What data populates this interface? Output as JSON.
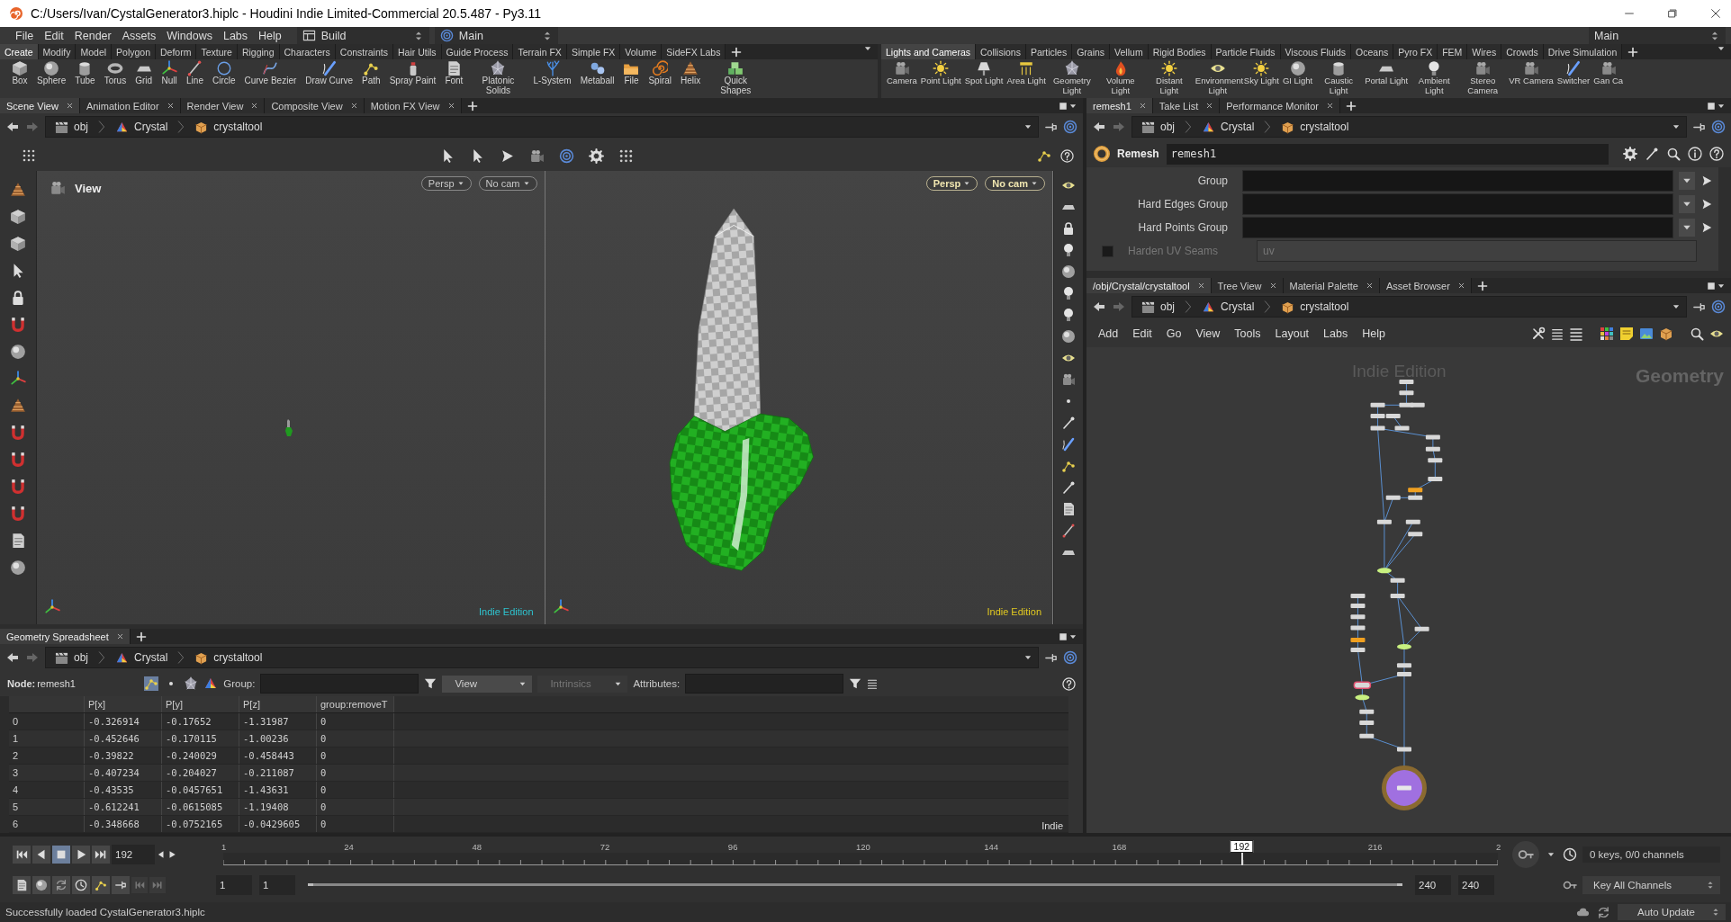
{
  "window": {
    "title": "C:/Users/Ivan/CystalGenerator3.hiplc - Houdini Indie Limited-Commercial 20.5.487 - Py3.11"
  },
  "menu": [
    "File",
    "Edit",
    "Render",
    "Assets",
    "Windows",
    "Labs",
    "Help"
  ],
  "desktop": "Build",
  "context": "Main",
  "right_selector": "Main",
  "shelves": [
    {
      "tabs": [
        {
          "label": "Create",
          "selected": true
        },
        {
          "label": "Modify",
          "selected": false
        },
        {
          "label": "Model",
          "selected": false
        },
        {
          "label": "Polygon",
          "selected": false
        },
        {
          "label": "Deform",
          "selected": false
        },
        {
          "label": "Texture",
          "selected": false
        },
        {
          "label": "Rigging",
          "selected": false
        },
        {
          "label": "Characters",
          "selected": false
        },
        {
          "label": "Constraints",
          "selected": false
        },
        {
          "label": "Hair Utils",
          "selected": false
        },
        {
          "label": "Guide Process",
          "selected": false
        },
        {
          "label": "Terrain FX",
          "selected": false
        },
        {
          "label": "Simple FX",
          "selected": false
        },
        {
          "label": "Volume",
          "selected": false
        },
        {
          "label": "SideFX Labs",
          "selected": false
        }
      ],
      "tools": [
        "Box",
        "Sphere",
        "Tube",
        "Torus",
        "Grid",
        "Null",
        "Line",
        "Circle",
        "Curve Bezier",
        "Draw Curve",
        "Path",
        "Spray Paint",
        "Font",
        "Platonic Solids",
        "L-System",
        "Metaball",
        "File",
        "Spiral",
        "Helix",
        "Quick Shapes"
      ]
    },
    {
      "tabs": [
        {
          "label": "Lights and Cameras",
          "selected": true
        },
        {
          "label": "Collisions",
          "selected": false
        },
        {
          "label": "Particles",
          "selected": false
        },
        {
          "label": "Grains",
          "selected": false
        },
        {
          "label": "Vellum",
          "selected": false
        },
        {
          "label": "Rigid Bodies",
          "selected": false
        },
        {
          "label": "Particle Fluids",
          "selected": false
        },
        {
          "label": "Viscous Fluids",
          "selected": false
        },
        {
          "label": "Oceans",
          "selected": false
        },
        {
          "label": "Pyro FX",
          "selected": false
        },
        {
          "label": "FEM",
          "selected": false
        },
        {
          "label": "Wires",
          "selected": false
        },
        {
          "label": "Crowds",
          "selected": false
        },
        {
          "label": "Drive Simulation",
          "selected": false
        }
      ],
      "tools": [
        "Camera",
        "Point Light",
        "Spot Light",
        "Area Light",
        "Geometry Light",
        "Volume Light",
        "Distant Light",
        "Environment Light",
        "Sky Light",
        "GI Light",
        "Caustic Light",
        "Portal Light",
        "Ambient Light",
        "Stereo Camera",
        "VR Camera",
        "Switcher",
        "Gan Ca"
      ]
    }
  ],
  "scene": {
    "tabs": [
      {
        "label": "Scene View",
        "selected": true
      },
      {
        "label": "Animation Editor",
        "selected": false
      },
      {
        "label": "Render View",
        "selected": false
      },
      {
        "label": "Composite View",
        "selected": false
      },
      {
        "label": "Motion FX View",
        "selected": false
      }
    ],
    "path": [
      "obj",
      "Crystal",
      "crystaltool"
    ],
    "viewports": [
      {
        "title": "View",
        "projection": "Persp",
        "camera": "No cam",
        "watermark": "Indie Edition",
        "active": false
      },
      {
        "projection": "Persp",
        "camera": "No cam",
        "watermark": "Indie Edition",
        "active": true
      }
    ]
  },
  "spreadsheet": {
    "tabs": [
      {
        "label": "Geometry Spreadsheet",
        "selected": true
      }
    ],
    "path": [
      "obj",
      "Crystal",
      "crystaltool"
    ],
    "node_label": "Node:",
    "node": "remesh1",
    "group_label": "Group:",
    "view": "View",
    "intrinsics": "Intrinsics",
    "attributes_label": "Attributes:",
    "columns": [
      "P[x]",
      "P[y]",
      "P[z]",
      "group:removeT"
    ],
    "rows": [
      {
        "index": "0",
        "cells": [
          "-0.326914",
          "-0.17652",
          "-1.31987",
          "0"
        ]
      },
      {
        "index": "1",
        "cells": [
          "-0.452646",
          "-0.170115",
          "-1.00236",
          "0"
        ]
      },
      {
        "index": "2",
        "cells": [
          "-0.39822",
          "-0.240029",
          "-0.458443",
          "0"
        ]
      },
      {
        "index": "3",
        "cells": [
          "-0.407234",
          "-0.204027",
          "-0.211087",
          "0"
        ]
      },
      {
        "index": "4",
        "cells": [
          "-0.43535",
          "-0.0457651",
          "-1.43631",
          "0"
        ]
      },
      {
        "index": "5",
        "cells": [
          "-0.612241",
          "-0.0615085",
          "-1.19408",
          "0"
        ]
      },
      {
        "index": "6",
        "cells": [
          "-0.348668",
          "-0.0752165",
          "-0.0429605",
          "0"
        ]
      }
    ],
    "watermark": "Indie"
  },
  "parameters": {
    "tabs": [
      {
        "label": "remesh1",
        "selected": true
      },
      {
        "label": "Take List",
        "selected": false
      },
      {
        "label": "Performance Monitor",
        "selected": false
      }
    ],
    "path": [
      "obj",
      "Crystal",
      "crystaltool"
    ],
    "node_type": "Remesh",
    "node_name": "remesh1",
    "fields": [
      {
        "kind": "text",
        "label": "Group"
      },
      {
        "kind": "text",
        "label": "Hard Edges Group"
      },
      {
        "kind": "text",
        "label": "Hard Points Group"
      },
      {
        "kind": "checkbox",
        "label": "Harden UV Seams",
        "checked": false,
        "disabled": true,
        "value": "uv"
      }
    ]
  },
  "network": {
    "tabs": [
      {
        "label": "/obj/Crystal/crystaltool",
        "selected": true
      },
      {
        "label": "Tree View",
        "selected": false
      },
      {
        "label": "Material Palette",
        "selected": false
      },
      {
        "label": "Asset Browser",
        "selected": false
      }
    ],
    "path": [
      "obj",
      "Crystal",
      "crystaltool"
    ],
    "menu": [
      "Add",
      "Edit",
      "Go",
      "View",
      "Tools",
      "Layout",
      "Labs",
      "Help"
    ],
    "watermark": "Indie Edition",
    "context_label": "Geometry"
  },
  "timeline": {
    "frame": "192",
    "playing": false,
    "ticks": [
      "1",
      "24",
      "48",
      "72",
      "96",
      "120",
      "144",
      "168",
      "216",
      "2"
    ],
    "current": "192",
    "level": 0.799,
    "start": "1",
    "range_start": "1",
    "range_end": "240",
    "end": "240",
    "keys": "0 keys, 0/0 channels",
    "key_mode": "Key All Channels"
  },
  "status": {
    "message": "Successfully loaded CystalGenerator3.hiplc",
    "update_mode": "Auto Update"
  }
}
